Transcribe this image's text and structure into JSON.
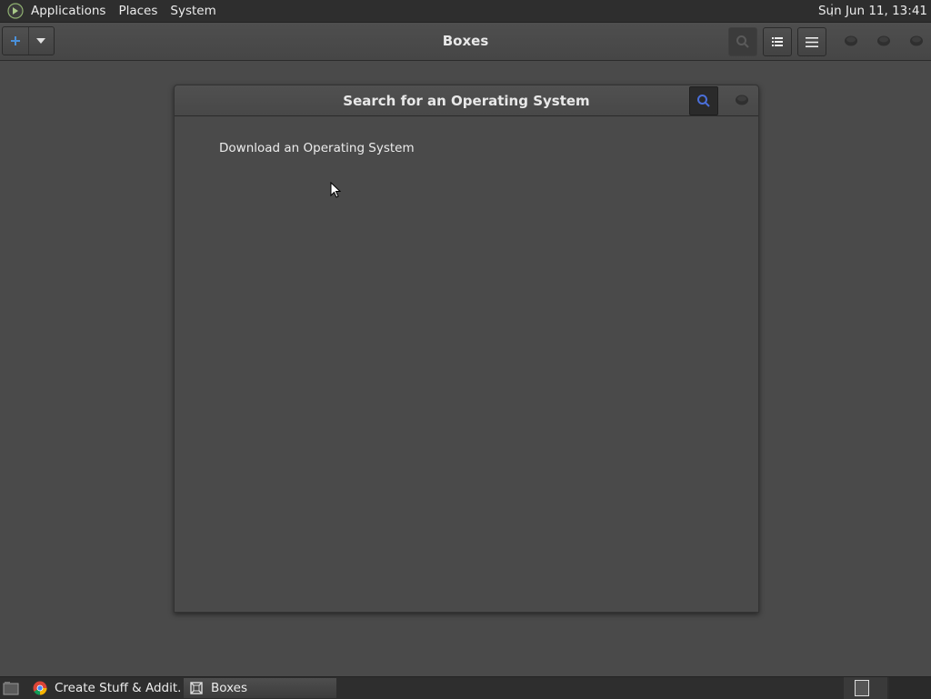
{
  "top_panel": {
    "logo_icon": "mint-logo-icon",
    "menus": [
      "Applications",
      "Places",
      "System"
    ],
    "clock": "Sun Jun 11, 13:41"
  },
  "headerbar": {
    "title": "Boxes",
    "new_button_icon": "plus-icon",
    "buttons": [
      "search-icon",
      "list-view-icon",
      "menu-icon"
    ],
    "window_controls": [
      "minimize-icon",
      "maximize-icon",
      "close-icon"
    ]
  },
  "dialog": {
    "title": "Search for an Operating System",
    "download_link": "Download an Operating System"
  },
  "bottom_panel": {
    "tasks": [
      {
        "label": "Create Stuff & Addit...",
        "icon": "chrome-icon"
      },
      {
        "label": "Boxes",
        "icon": "boxes-icon"
      }
    ]
  },
  "colors": {
    "panel": "#2e2e2e",
    "background": "#4a4a4a",
    "accent": "#4a90d9"
  }
}
